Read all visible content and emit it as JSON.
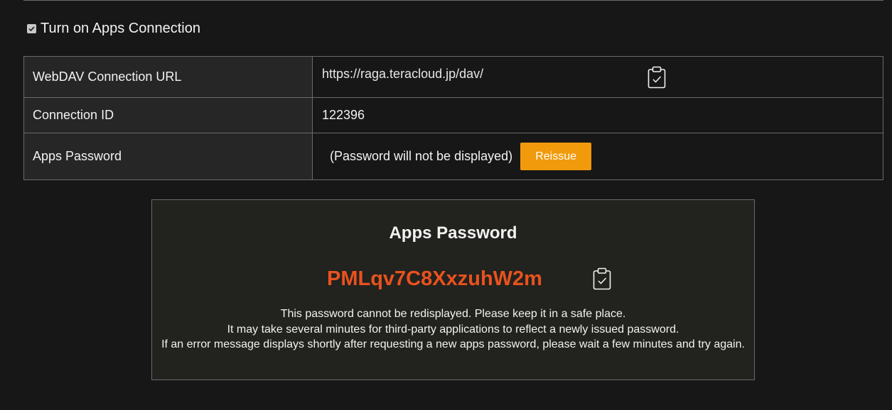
{
  "apps_connection": {
    "checked": true,
    "label": "Turn on Apps Connection"
  },
  "table": {
    "rows": [
      {
        "label": "WebDAV Connection URL",
        "value": "https://raga.teracloud.jp/dav/"
      },
      {
        "label": "Connection ID",
        "value": "122396"
      },
      {
        "label": "Apps Password",
        "value": "(Password will not be displayed)"
      }
    ],
    "reissue_label": "Reissue",
    "copy_icon": "clipboard-check-icon"
  },
  "panel": {
    "title": "Apps Password",
    "password": "PMLqv7C8XxzuhW2m",
    "copy_icon": "clipboard-check-icon",
    "messages": [
      "This password cannot be redisplayed. Please keep it in a safe place.",
      "It may take several minutes for third-party applications to reflect a newly issued password.",
      "If an error message displays shortly after requesting a new apps password, please wait a few minutes and try again."
    ]
  },
  "colors": {
    "background": "#171717",
    "label_cell": "#262626",
    "border": "#6a6a6a",
    "accent_button": "#f09a0c",
    "password_text": "#e8521f",
    "panel_background": "#22221e"
  }
}
